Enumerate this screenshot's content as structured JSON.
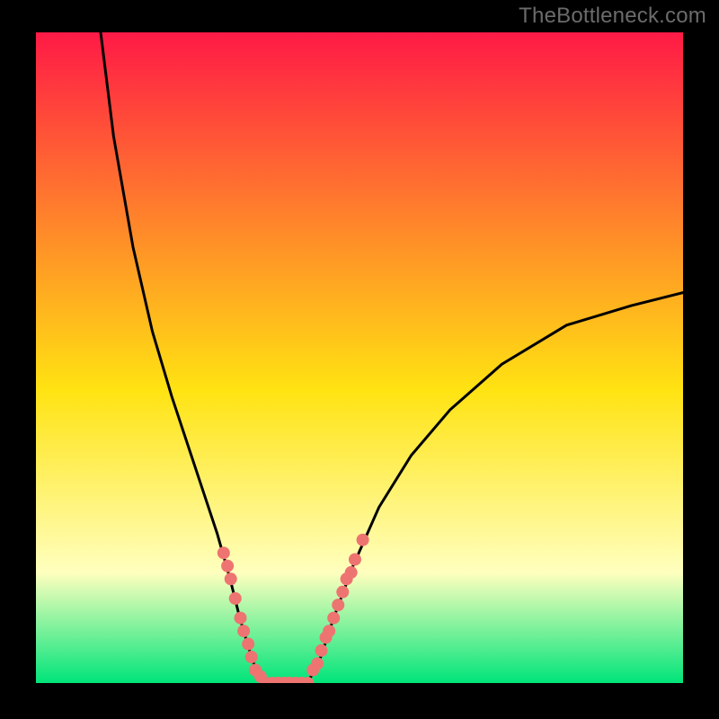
{
  "watermark": "TheBottleneck.com",
  "colors": {
    "background": "#000000",
    "watermark": "#6b6b6b",
    "curve": "#000000",
    "point_fill": "#ed7471",
    "grad_top": "#ff1a46",
    "grad_mid": "#ffe312",
    "grad_low": "#ffffbe",
    "grad_bottom": "#00e47a"
  },
  "chart_data": {
    "type": "line",
    "title": "",
    "xlabel": "",
    "ylabel": "",
    "xlim": [
      0,
      100
    ],
    "ylim": [
      0,
      100
    ],
    "series": [
      {
        "name": "curve-left",
        "x": [
          10,
          12,
          15,
          18,
          21,
          24,
          26,
          28,
          30,
          31.5,
          33,
          34,
          35
        ],
        "values": [
          100,
          84,
          67,
          54,
          44,
          35,
          29,
          23,
          16,
          10,
          5,
          2,
          0
        ]
      },
      {
        "name": "valley-floor",
        "x": [
          35,
          36,
          37,
          38,
          39,
          40,
          41,
          42
        ],
        "values": [
          0,
          0,
          0,
          0,
          0,
          0,
          0,
          0
        ]
      },
      {
        "name": "curve-right",
        "x": [
          42,
          44,
          46,
          49,
          53,
          58,
          64,
          72,
          82,
          92,
          100
        ],
        "values": [
          0,
          4,
          10,
          18,
          27,
          35,
          42,
          49,
          55,
          58,
          60
        ]
      }
    ],
    "points": [
      {
        "x": 29.0,
        "y": 20
      },
      {
        "x": 29.6,
        "y": 18
      },
      {
        "x": 30.1,
        "y": 16
      },
      {
        "x": 30.8,
        "y": 13
      },
      {
        "x": 31.6,
        "y": 10
      },
      {
        "x": 32.1,
        "y": 8
      },
      {
        "x": 32.8,
        "y": 6
      },
      {
        "x": 33.3,
        "y": 4
      },
      {
        "x": 33.9,
        "y": 2
      },
      {
        "x": 34.7,
        "y": 1
      },
      {
        "x": 35.5,
        "y": 0
      },
      {
        "x": 36.5,
        "y": 0
      },
      {
        "x": 37.4,
        "y": 0
      },
      {
        "x": 38.3,
        "y": 0
      },
      {
        "x": 39.1,
        "y": 0
      },
      {
        "x": 40.0,
        "y": 0
      },
      {
        "x": 41.0,
        "y": 0
      },
      {
        "x": 42.0,
        "y": 0
      },
      {
        "x": 42.8,
        "y": 2
      },
      {
        "x": 43.5,
        "y": 3
      },
      {
        "x": 44.1,
        "y": 5
      },
      {
        "x": 44.8,
        "y": 7
      },
      {
        "x": 45.3,
        "y": 8
      },
      {
        "x": 46.0,
        "y": 10
      },
      {
        "x": 46.7,
        "y": 12
      },
      {
        "x": 47.4,
        "y": 14
      },
      {
        "x": 48.0,
        "y": 16
      },
      {
        "x": 48.7,
        "y": 17
      },
      {
        "x": 49.3,
        "y": 19
      },
      {
        "x": 50.5,
        "y": 22
      }
    ]
  }
}
